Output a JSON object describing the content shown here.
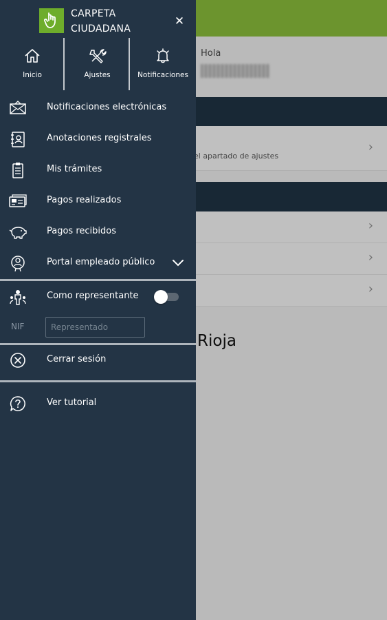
{
  "background": {
    "greeting": "Hola",
    "settings_hint": "el apartado de ajustes",
    "region": "Rioja"
  },
  "brand": {
    "line1": "CARPETA",
    "line2": "CIUDADANA",
    "accent_color": "#6ead2b"
  },
  "top_nav": [
    {
      "label": "Inicio",
      "icon": "home-icon"
    },
    {
      "label": "Ajustes",
      "icon": "tools-icon"
    },
    {
      "label": "Notificaciones",
      "icon": "bell-icon"
    }
  ],
  "menu": [
    {
      "label": "Notificaciones electrónicas",
      "icon": "envelope-icon"
    },
    {
      "label": "Anotaciones registrales",
      "icon": "contact-book-icon"
    },
    {
      "label": "Mis trámites",
      "icon": "clipboard-icon"
    },
    {
      "label": "Pagos realizados",
      "icon": "payment-card-icon"
    },
    {
      "label": "Pagos recibidos",
      "icon": "piggy-bank-icon"
    },
    {
      "label": "Portal empleado público",
      "icon": "employee-portal-icon"
    }
  ],
  "representative": {
    "label": "Como representante",
    "toggle_on": false,
    "nif_label": "NIF",
    "nif_placeholder": "Representado",
    "nif_value": ""
  },
  "logout": {
    "label": "Cerrar sesión"
  },
  "tutorial": {
    "label": "Ver tutorial"
  },
  "colors": {
    "drawer_bg": "#233445",
    "header_green": "#88b93a"
  }
}
